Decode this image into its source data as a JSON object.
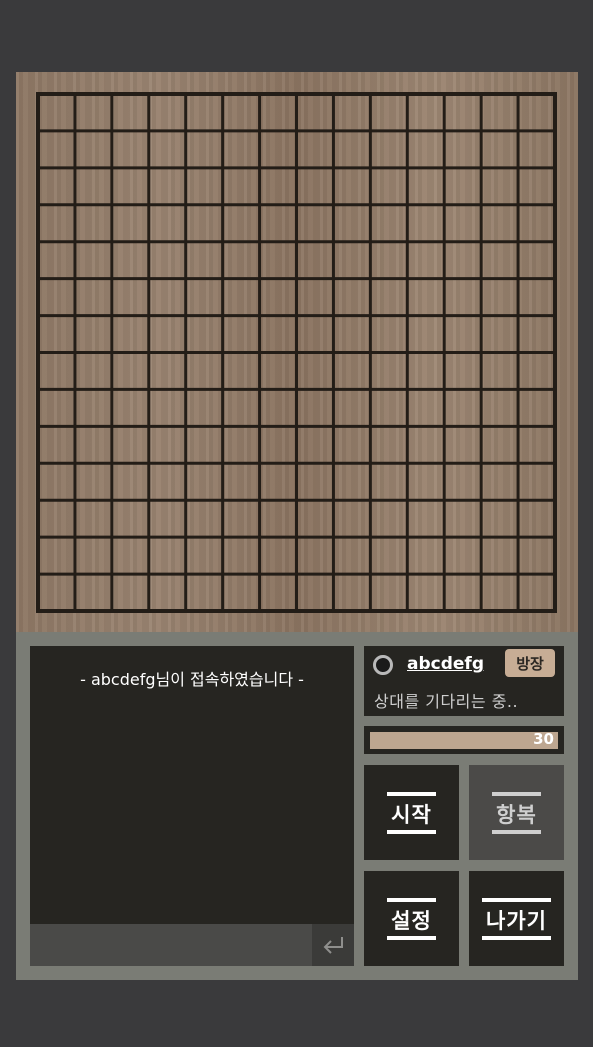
{
  "board": {
    "cells": 14
  },
  "chat": {
    "message": "- abcdefg님이 접속하였습니다 -",
    "input_value": "",
    "send_icon": "enter-arrow-icon"
  },
  "player": {
    "name": "abcdefg",
    "badge": "방장",
    "status": "상대를 기다리는 중..",
    "stone_icon": "white-stone-icon"
  },
  "timer": {
    "value": "30",
    "fill_fraction": 1.0
  },
  "buttons": {
    "start": "시작",
    "surrender": "항복",
    "settings": "설정",
    "exit": "나가기"
  },
  "colors": {
    "accent": "#bda690",
    "panel": "#7a7c75",
    "dark": "#262521"
  }
}
